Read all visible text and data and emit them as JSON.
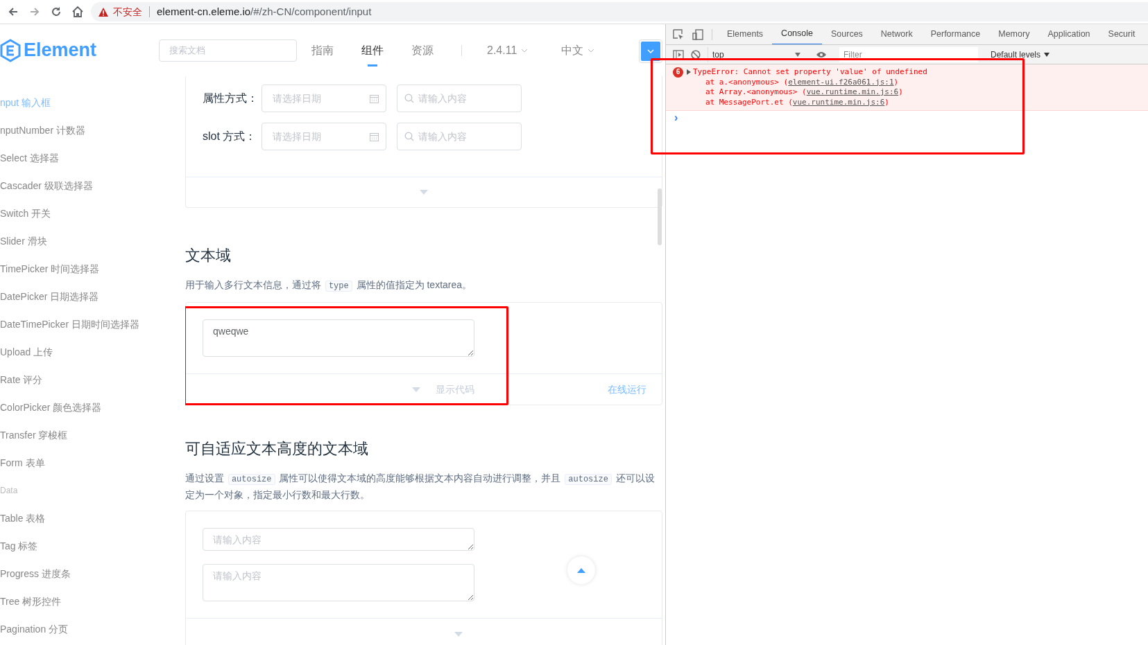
{
  "browser": {
    "warning": "不安全",
    "url_host": "element-cn.eleme.io",
    "url_path": "/#/zh-CN/component/input"
  },
  "header": {
    "logo": "Element",
    "search": {
      "placeholder": "搜索文档"
    },
    "nav": [
      {
        "label": "指南",
        "selected": false
      },
      {
        "label": "组件",
        "selected": true
      },
      {
        "label": "资源",
        "selected": false
      }
    ],
    "version": "2.4.11",
    "language": "中文"
  },
  "sidebar": {
    "items": [
      {
        "kind": "item",
        "label": "nput 输入框",
        "selected": true
      },
      {
        "kind": "item",
        "label": "nputNumber 计数器",
        "selected": false
      },
      {
        "kind": "item",
        "label": "Select 选择器",
        "selected": false
      },
      {
        "kind": "item",
        "label": "Cascader 级联选择器",
        "selected": false
      },
      {
        "kind": "item",
        "label": "Switch 开关",
        "selected": false
      },
      {
        "kind": "item",
        "label": "Slider 滑块",
        "selected": false
      },
      {
        "kind": "item",
        "label": "TimePicker 时间选择器",
        "selected": false
      },
      {
        "kind": "item",
        "label": "DatePicker 日期选择器",
        "selected": false
      },
      {
        "kind": "item",
        "label": "DateTimePicker 日期时间选择器",
        "selected": false
      },
      {
        "kind": "item",
        "label": "Upload 上传",
        "selected": false
      },
      {
        "kind": "item",
        "label": "Rate 评分",
        "selected": false
      },
      {
        "kind": "item",
        "label": "ColorPicker 颜色选择器",
        "selected": false
      },
      {
        "kind": "item",
        "label": "Transfer 穿梭框",
        "selected": false
      },
      {
        "kind": "item",
        "label": "Form 表单",
        "selected": false
      },
      {
        "kind": "group",
        "label": "Data"
      },
      {
        "kind": "item",
        "label": "Table 表格",
        "selected": false
      },
      {
        "kind": "item",
        "label": "Tag 标签",
        "selected": false
      },
      {
        "kind": "item",
        "label": "Progress 进度条",
        "selected": false
      },
      {
        "kind": "item",
        "label": "Tree 树形控件",
        "selected": false
      },
      {
        "kind": "item",
        "label": "Pagination 分页",
        "selected": false
      }
    ]
  },
  "content": {
    "demo_top": {
      "rows": [
        {
          "label": "属性方式：",
          "date_placeholder": "请选择日期",
          "search_placeholder": "请输入内容"
        },
        {
          "label": "slot 方式：",
          "date_placeholder": "请选择日期",
          "search_placeholder": "请输入内容"
        }
      ]
    },
    "sections": [
      {
        "title": "文本域",
        "description": [
          {
            "kind": "text",
            "text": "用于输入多行文本信息，通过将 "
          },
          {
            "kind": "code",
            "text": "type"
          },
          {
            "kind": "text",
            "text": " 属性的值指定为 textarea。"
          }
        ],
        "demo": {
          "highlighted": true,
          "textareas": [
            {
              "value": "qweqwe",
              "kind": "tall"
            }
          ],
          "show_code": "显示代码",
          "run_online": "在线运行"
        }
      },
      {
        "title": "可自适应文本高度的文本域",
        "description": [
          {
            "kind": "text",
            "text": "通过设置 "
          },
          {
            "kind": "code",
            "text": "autosize"
          },
          {
            "kind": "text",
            "text": " 属性可以使得文本域的高度能够根据文本内容自动进行调整，并且 "
          },
          {
            "kind": "code",
            "text": "autosize"
          },
          {
            "kind": "text",
            "text": " 还可以设定为一个对象，指定最小行数和最大行数。"
          }
        ],
        "demo": {
          "highlighted": false,
          "textareas": [
            {
              "placeholder": "请输入内容",
              "kind": "short"
            },
            {
              "placeholder": "请输入内容",
              "kind": "tall"
            }
          ]
        }
      }
    ]
  },
  "devtools": {
    "tabs": [
      {
        "label": "Elements",
        "selected": false
      },
      {
        "label": "Console",
        "selected": true
      },
      {
        "label": "Sources",
        "selected": false
      },
      {
        "label": "Network",
        "selected": false
      },
      {
        "label": "Performance",
        "selected": false
      },
      {
        "label": "Memory",
        "selected": false
      },
      {
        "label": "Application",
        "selected": false
      },
      {
        "label": "Securit",
        "selected": false
      }
    ],
    "context": "top",
    "filter": {
      "placeholder": "Filter"
    },
    "levels": "Default levels",
    "highlighted": true,
    "error": {
      "count": "6",
      "message": "TypeError: Cannot set property 'value' of undefined",
      "stack": [
        {
          "prefix": "at a.<anonymous> (",
          "link": "element-ui.f26a061.js:1",
          "suffix": ")"
        },
        {
          "prefix": "at Array.<anonymous> (",
          "link": "vue.runtime.min.js:6",
          "suffix": ")"
        },
        {
          "prefix": "at MessagePort.et (",
          "link": "vue.runtime.min.js:6",
          "suffix": ")"
        }
      ]
    },
    "prompt": "›"
  }
}
